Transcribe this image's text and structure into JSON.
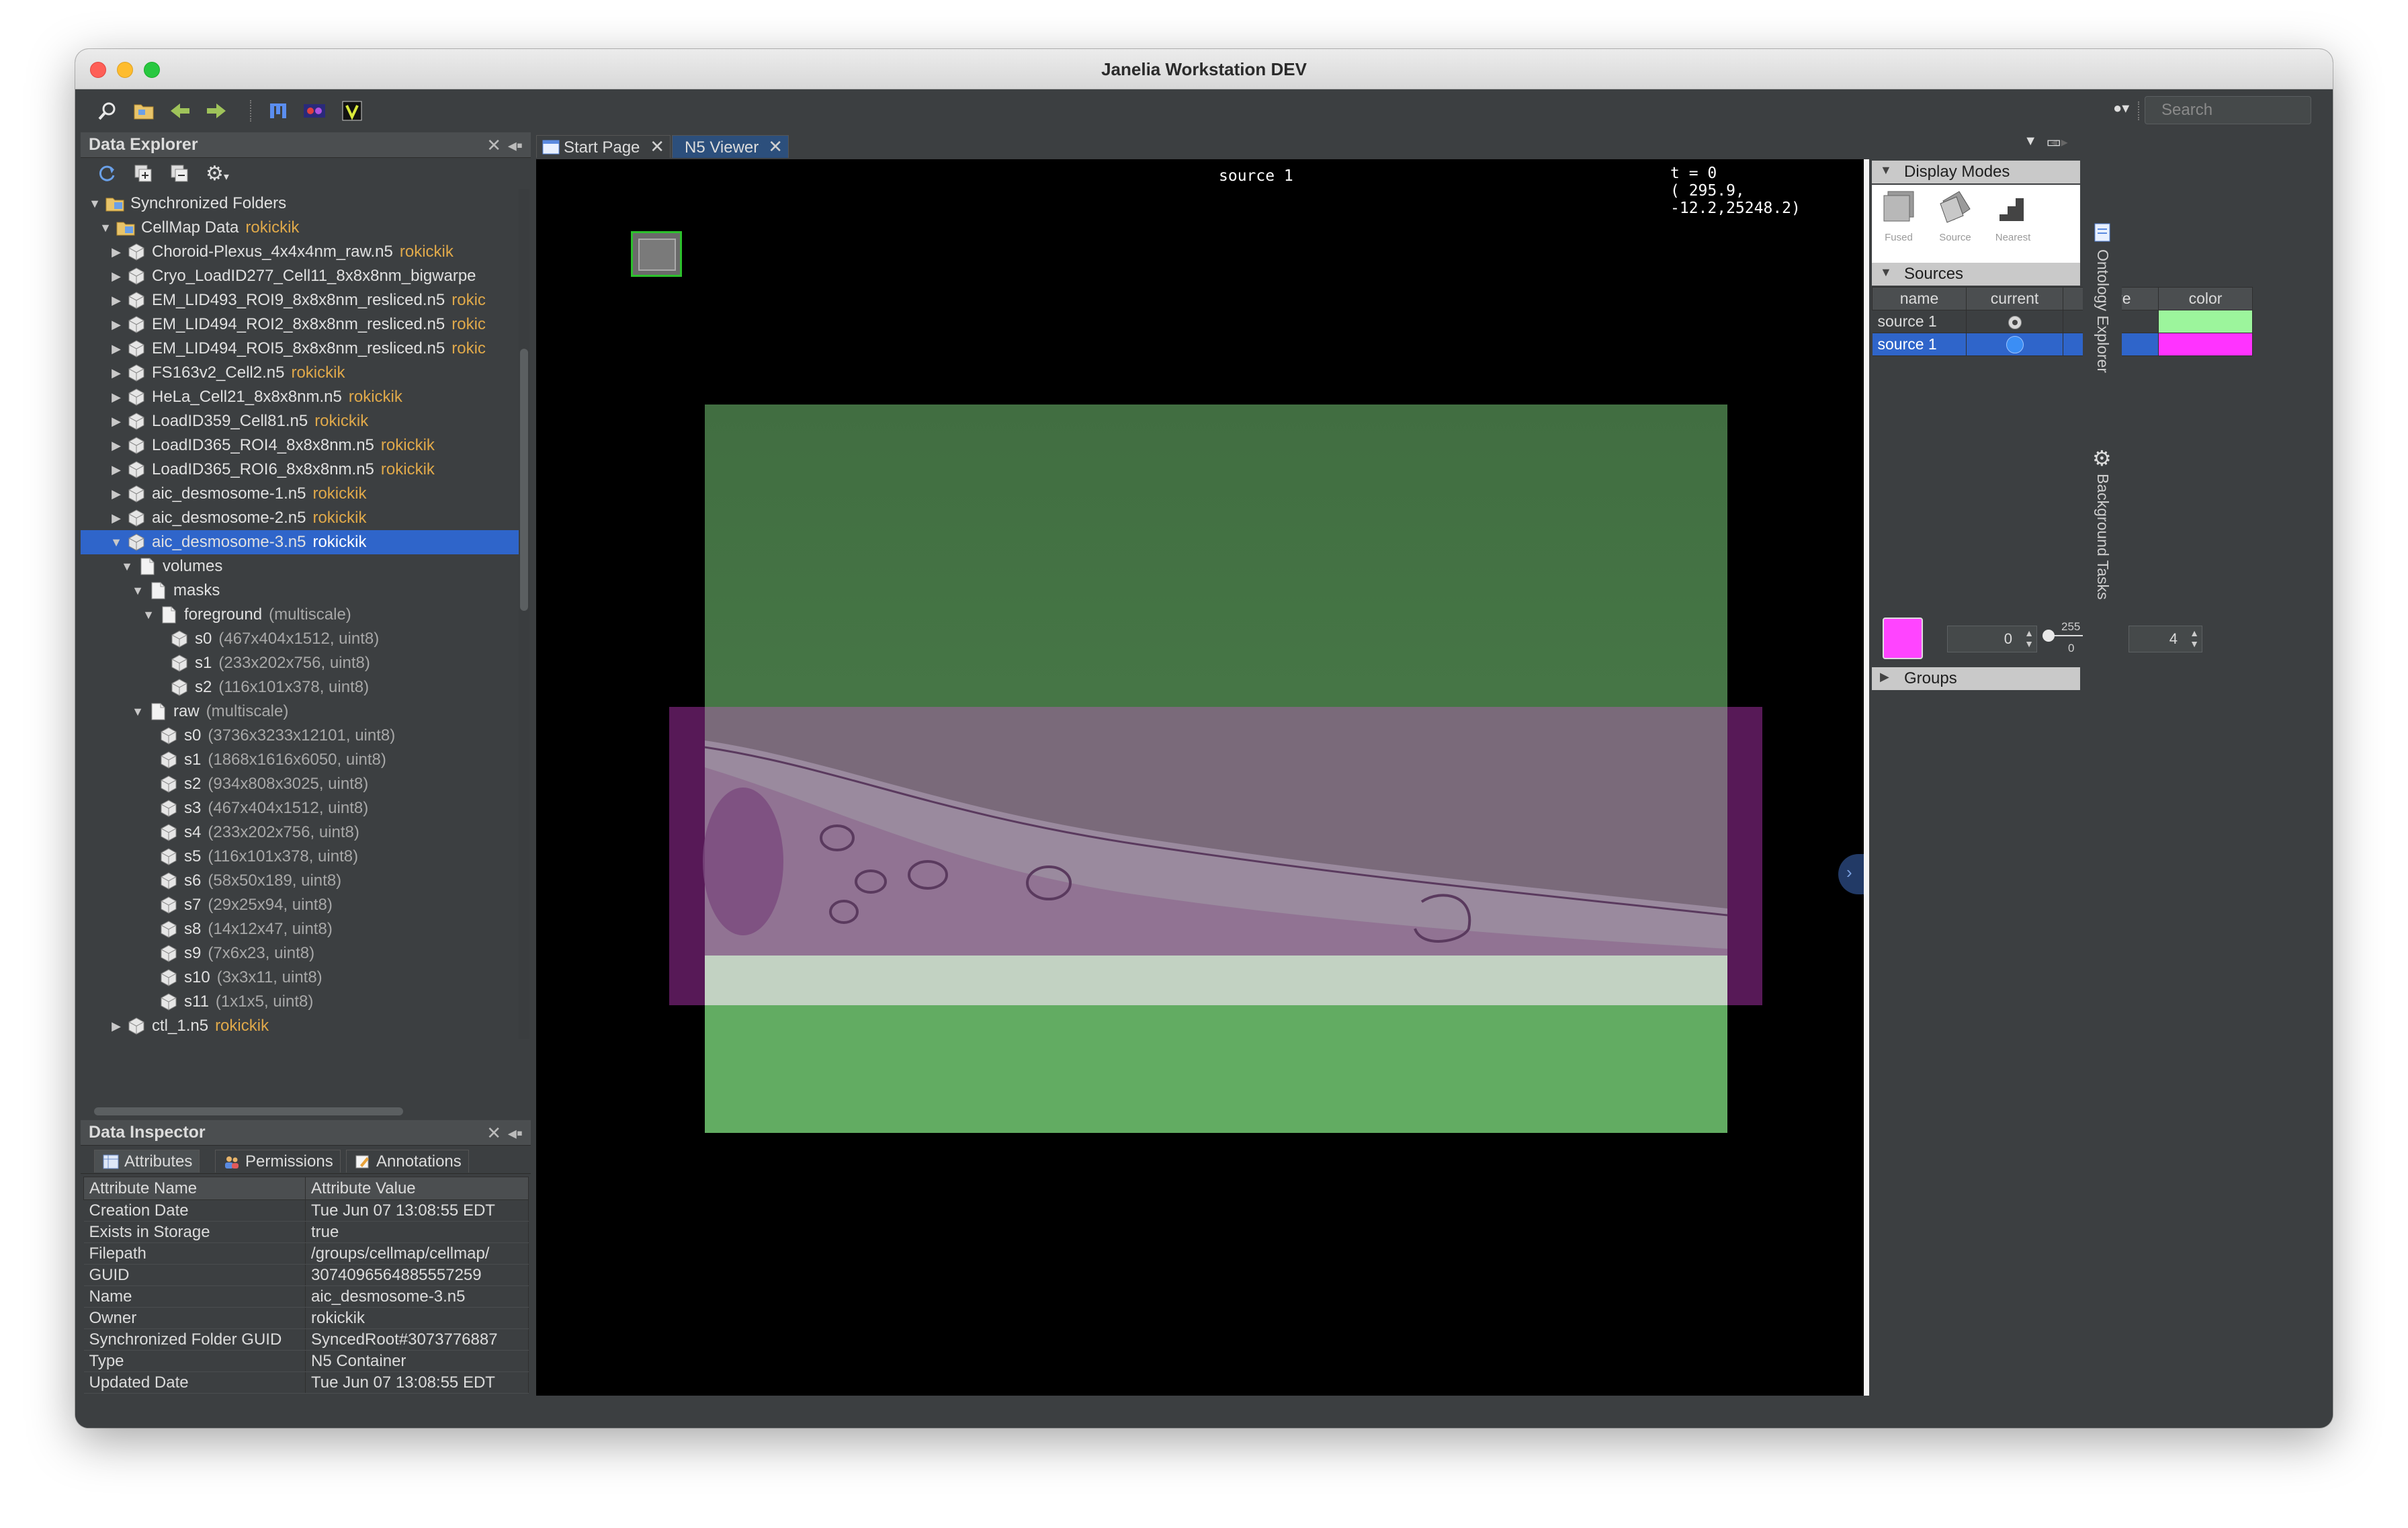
{
  "window": {
    "title": "Janelia Workstation DEV",
    "search_placeholder": "Search"
  },
  "toolbar": {
    "icons": [
      "search-icon",
      "open-folder-icon",
      "back-arrow-icon",
      "forward-arrow-icon",
      "fiji-icon",
      "n5-viewer-icon",
      "vaa3d-icon"
    ]
  },
  "explorer": {
    "title": "Data Explorer",
    "tree": [
      {
        "label": "Synchronized Folders",
        "owner": "",
        "meta": "",
        "indent": 0,
        "arrow": "down",
        "icon": "folder"
      },
      {
        "label": "CellMap Data",
        "owner": "rokickik",
        "meta": "",
        "indent": 1,
        "arrow": "down",
        "icon": "folder"
      },
      {
        "label": "Choroid-Plexus_4x4x4nm_raw.n5",
        "owner": "rokickik",
        "meta": "",
        "indent": 2,
        "arrow": "right",
        "icon": "cube"
      },
      {
        "label": "Cryo_LoadID277_Cell11_8x8x8nm_bigwarpe",
        "owner": "",
        "meta": "",
        "indent": 2,
        "arrow": "right",
        "icon": "cube"
      },
      {
        "label": "EM_LID493_ROI9_8x8x8nm_resliced.n5",
        "owner": "rokic",
        "meta": "",
        "indent": 2,
        "arrow": "right",
        "icon": "cube"
      },
      {
        "label": "EM_LID494_ROI2_8x8x8nm_resliced.n5",
        "owner": "rokic",
        "meta": "",
        "indent": 2,
        "arrow": "right",
        "icon": "cube"
      },
      {
        "label": "EM_LID494_ROI5_8x8x8nm_resliced.n5",
        "owner": "rokic",
        "meta": "",
        "indent": 2,
        "arrow": "right",
        "icon": "cube"
      },
      {
        "label": "FS163v2_Cell2.n5",
        "owner": "rokickik",
        "meta": "",
        "indent": 2,
        "arrow": "right",
        "icon": "cube"
      },
      {
        "label": "HeLa_Cell21_8x8x8nm.n5",
        "owner": "rokickik",
        "meta": "",
        "indent": 2,
        "arrow": "right",
        "icon": "cube"
      },
      {
        "label": "LoadID359_Cell81.n5",
        "owner": "rokickik",
        "meta": "",
        "indent": 2,
        "arrow": "right",
        "icon": "cube"
      },
      {
        "label": "LoadID365_ROI4_8x8x8nm.n5",
        "owner": "rokickik",
        "meta": "",
        "indent": 2,
        "arrow": "right",
        "icon": "cube"
      },
      {
        "label": "LoadID365_ROI6_8x8x8nm.n5",
        "owner": "rokickik",
        "meta": "",
        "indent": 2,
        "arrow": "right",
        "icon": "cube"
      },
      {
        "label": "aic_desmosome-1.n5",
        "owner": "rokickik",
        "meta": "",
        "indent": 2,
        "arrow": "right",
        "icon": "cube"
      },
      {
        "label": "aic_desmosome-2.n5",
        "owner": "rokickik",
        "meta": "",
        "indent": 2,
        "arrow": "right",
        "icon": "cube"
      },
      {
        "label": "aic_desmosome-3.n5",
        "owner": "rokickik",
        "meta": "",
        "indent": 2,
        "arrow": "down",
        "icon": "cube",
        "selected": true
      },
      {
        "label": "volumes",
        "owner": "",
        "meta": "",
        "indent": 3,
        "arrow": "down",
        "icon": "page"
      },
      {
        "label": "masks",
        "owner": "",
        "meta": "",
        "indent": 4,
        "arrow": "down",
        "icon": "page"
      },
      {
        "label": "foreground",
        "owner": "",
        "meta": "(multiscale)",
        "indent": 5,
        "arrow": "down",
        "icon": "page"
      },
      {
        "label": "s0",
        "owner": "",
        "meta": "(467x404x1512, uint8)",
        "indent": 6,
        "arrow": "",
        "icon": "cube"
      },
      {
        "label": "s1",
        "owner": "",
        "meta": "(233x202x756, uint8)",
        "indent": 6,
        "arrow": "",
        "icon": "cube"
      },
      {
        "label": "s2",
        "owner": "",
        "meta": "(116x101x378, uint8)",
        "indent": 6,
        "arrow": "",
        "icon": "cube"
      },
      {
        "label": "raw",
        "owner": "",
        "meta": "(multiscale)",
        "indent": 4,
        "arrow": "down",
        "icon": "page"
      },
      {
        "label": "s0",
        "owner": "",
        "meta": "(3736x3233x12101, uint8)",
        "indent": 5,
        "arrow": "",
        "icon": "cube"
      },
      {
        "label": "s1",
        "owner": "",
        "meta": "(1868x1616x6050, uint8)",
        "indent": 5,
        "arrow": "",
        "icon": "cube"
      },
      {
        "label": "s2",
        "owner": "",
        "meta": "(934x808x3025, uint8)",
        "indent": 5,
        "arrow": "",
        "icon": "cube"
      },
      {
        "label": "s3",
        "owner": "",
        "meta": "(467x404x1512, uint8)",
        "indent": 5,
        "arrow": "",
        "icon": "cube"
      },
      {
        "label": "s4",
        "owner": "",
        "meta": "(233x202x756, uint8)",
        "indent": 5,
        "arrow": "",
        "icon": "cube"
      },
      {
        "label": "s5",
        "owner": "",
        "meta": "(116x101x378, uint8)",
        "indent": 5,
        "arrow": "",
        "icon": "cube"
      },
      {
        "label": "s6",
        "owner": "",
        "meta": "(58x50x189, uint8)",
        "indent": 5,
        "arrow": "",
        "icon": "cube"
      },
      {
        "label": "s7",
        "owner": "",
        "meta": "(29x25x94, uint8)",
        "indent": 5,
        "arrow": "",
        "icon": "cube"
      },
      {
        "label": "s8",
        "owner": "",
        "meta": "(14x12x47, uint8)",
        "indent": 5,
        "arrow": "",
        "icon": "cube"
      },
      {
        "label": "s9",
        "owner": "",
        "meta": "(7x6x23, uint8)",
        "indent": 5,
        "arrow": "",
        "icon": "cube"
      },
      {
        "label": "s10",
        "owner": "",
        "meta": "(3x3x11, uint8)",
        "indent": 5,
        "arrow": "",
        "icon": "cube"
      },
      {
        "label": "s11",
        "owner": "",
        "meta": "(1x1x5, uint8)",
        "indent": 5,
        "arrow": "",
        "icon": "cube"
      },
      {
        "label": "ctl_1.n5",
        "owner": "rokickik",
        "meta": "",
        "indent": 2,
        "arrow": "right",
        "icon": "cube"
      }
    ]
  },
  "inspector": {
    "title": "Data Inspector",
    "tabs": [
      "Attributes",
      "Permissions",
      "Annotations"
    ],
    "columns": [
      "Attribute Name",
      "Attribute Value"
    ],
    "rows": [
      [
        "Creation Date",
        "Tue Jun 07 13:08:55 EDT"
      ],
      [
        "Exists in Storage",
        "true"
      ],
      [
        "Filepath",
        "/groups/cellmap/cellmap/"
      ],
      [
        "GUID",
        "3074096564885557259"
      ],
      [
        "Name",
        "aic_desmosome-3.n5"
      ],
      [
        "Owner",
        "rokickik"
      ],
      [
        "Synchronized Folder GUID",
        "SyncedRoot#3073776887"
      ],
      [
        "Type",
        "N5 Container"
      ],
      [
        "Updated Date",
        "Tue Jun 07 13:08:55 EDT"
      ]
    ]
  },
  "doc_tabs": [
    "Start Page",
    "N5 Viewer"
  ],
  "viewer": {
    "source_label": "source 1",
    "time_label": "t = 0",
    "coords_label": "( 295.9, -12.2,25248.2)"
  },
  "right_panel": {
    "display_modes_title": "Display Modes",
    "modes": [
      "Fused",
      "Source",
      "Nearest"
    ],
    "sources_title": "Sources",
    "sources_columns": [
      "name",
      "current",
      "active",
      "color"
    ],
    "sources": [
      {
        "name": "source 1",
        "color": "#9cf59c",
        "current": false
      },
      {
        "name": "source 1",
        "color": "#ff33ff",
        "current": true
      }
    ],
    "min_value": "0",
    "max_value": "4",
    "range_max": "255",
    "range_min": "0",
    "groups_title": "Groups"
  },
  "side_tabs": [
    "Ontology Explorer",
    "Background Tasks"
  ],
  "colors": {
    "selection": "#2f65ca",
    "owner": "#e0a94a",
    "green_overlay": "#5a9a5a",
    "magenta_overlay": "#8a2c8a"
  }
}
